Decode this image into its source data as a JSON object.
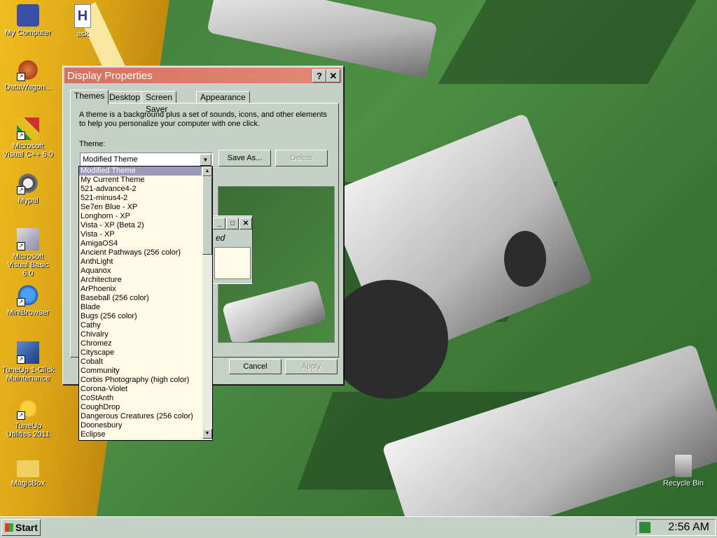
{
  "desktop": {
    "icons": [
      {
        "label": "My Computer",
        "icon": "computer-icon"
      },
      {
        "label": "ask",
        "icon": "document-icon"
      },
      {
        "label": "DataWagon...",
        "icon": "datawagon-icon"
      },
      {
        "label": "Microsoft Visual C++ 6.0",
        "icon": "visual-cpp-icon"
      },
      {
        "label": "Mypal",
        "icon": "mypal-browser-icon"
      },
      {
        "label": "Microsoft Visual Basic 6.0",
        "icon": "visual-basic-icon"
      },
      {
        "label": "MiniBrowser",
        "icon": "minibrowser-icon"
      },
      {
        "label": "TuneUp 1-Click Maintenance",
        "icon": "tuneup-maintenance-icon"
      },
      {
        "label": "TuneUp Utilities 2011",
        "icon": "tuneup-utilities-icon"
      },
      {
        "label": "MagicBox",
        "icon": "folder-icon"
      },
      {
        "label": "Recycle Bin",
        "icon": "recycle-bin-icon"
      }
    ]
  },
  "dialog": {
    "title": "Display Properties",
    "help_glyph": "?",
    "close_glyph": "✕",
    "tabs": [
      {
        "label": "Themes"
      },
      {
        "label": "Desktop"
      },
      {
        "label": "Screen Saver"
      },
      {
        "label": "Appearance"
      }
    ],
    "description": "A theme is a background plus a set of sounds, icons, and other elements to help you personalize your computer with one click.",
    "theme_label": "Theme:",
    "theme_value": "Modified Theme",
    "save_as_label": "Save As...",
    "delete_label": "Delete",
    "cancel_label": "Cancel",
    "apply_label": "Apply",
    "preview_window_text": "ed"
  },
  "theme_list": {
    "items": [
      "Modified Theme",
      "My Current Theme",
      "521-advance4-2",
      "521-minus4-2",
      "Se7en Blue - XP",
      "Longhorn - XP",
      "Vista - XP (Beta 2)",
      "Vista - XP",
      "AmigaOS4",
      "Ancient Pathways (256 color)",
      "AnthLight",
      "Aquanox",
      "Architecture",
      "ArPhoenix",
      "Baseball (256 color)",
      "Blade",
      "Bugs (256 color)",
      "Cathy",
      "Chivalry",
      "Chromez",
      "Cityscape",
      "Cobalt",
      "Community",
      "Corbis Photography (high color)",
      "Corona-Violet",
      "CoStAnth",
      "CoughDrop",
      "Dangerous Creatures (256 color)",
      "Doonesbury",
      "Eclipse"
    ],
    "selected_index": 0
  },
  "taskbar": {
    "start_label": "Start",
    "clock": "2:56 AM"
  },
  "colors": {
    "title_bar": "#d8705f",
    "face": "#c4d1c4",
    "list_bg": "#fffbe6",
    "selection": "#9a9ab8"
  }
}
